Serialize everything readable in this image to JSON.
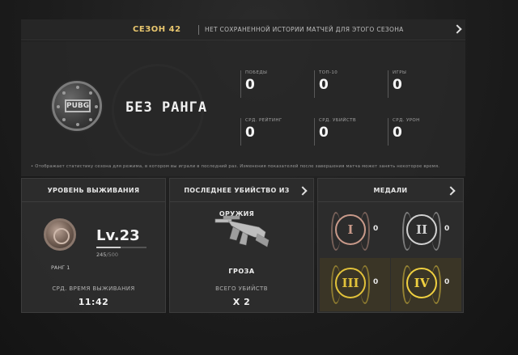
{
  "header": {
    "season": "СЕЗОН 42",
    "note": "НЕТ СОХРАНЕННОЙ ИСТОРИИ МАТЧЕЙ ДЛЯ ЭТОГО СЕЗОНА"
  },
  "rank": {
    "name": "БЕЗ РАНГА",
    "badge_text": "PUBG"
  },
  "stats": [
    {
      "label": "ПОБЕДЫ",
      "value": "0"
    },
    {
      "label": "ТОП-10",
      "value": "0"
    },
    {
      "label": "ИГРЫ",
      "value": "0"
    },
    {
      "label": "СРД. РЕЙТИНГ",
      "value": "0"
    },
    {
      "label": "СРД. УБИЙСТВ",
      "value": "0"
    },
    {
      "label": "СРД. УРОН",
      "value": "0"
    }
  ],
  "footnote": "Отображает статистику сезона для режима, в котором вы играли в последний раз. Изменения показателей после завершения матча может занять некоторое время.",
  "survival": {
    "title": "УРОВЕНЬ ВЫЖИВАНИЯ",
    "level": "Lv.23",
    "xp_current": "245",
    "xp_max": "/500",
    "xp_fraction": 0.49,
    "rank_label": "РАНГ 1",
    "avg_time_label": "СРД. ВРЕМЯ ВЫЖИВАНИЯ",
    "avg_time_value": "11:42"
  },
  "last_kill": {
    "title": "ПОСЛЕДНЕЕ УБИЙСТВО ИЗ ОРУЖИЯ",
    "weapon_name": "ГРОЗА",
    "total_kills_label": "ВСЕГО УБИЙСТВ",
    "total_kills_value": "X 2"
  },
  "medals": {
    "title": "МЕДАЛИ",
    "items": [
      {
        "numeral": "I",
        "count": "0",
        "color": "#c99a8a"
      },
      {
        "numeral": "II",
        "count": "0",
        "color": "#d0d0d0"
      },
      {
        "numeral": "III",
        "count": "0",
        "color": "#e2c23a"
      },
      {
        "numeral": "IV",
        "count": "0",
        "color": "#f0d040"
      }
    ]
  }
}
